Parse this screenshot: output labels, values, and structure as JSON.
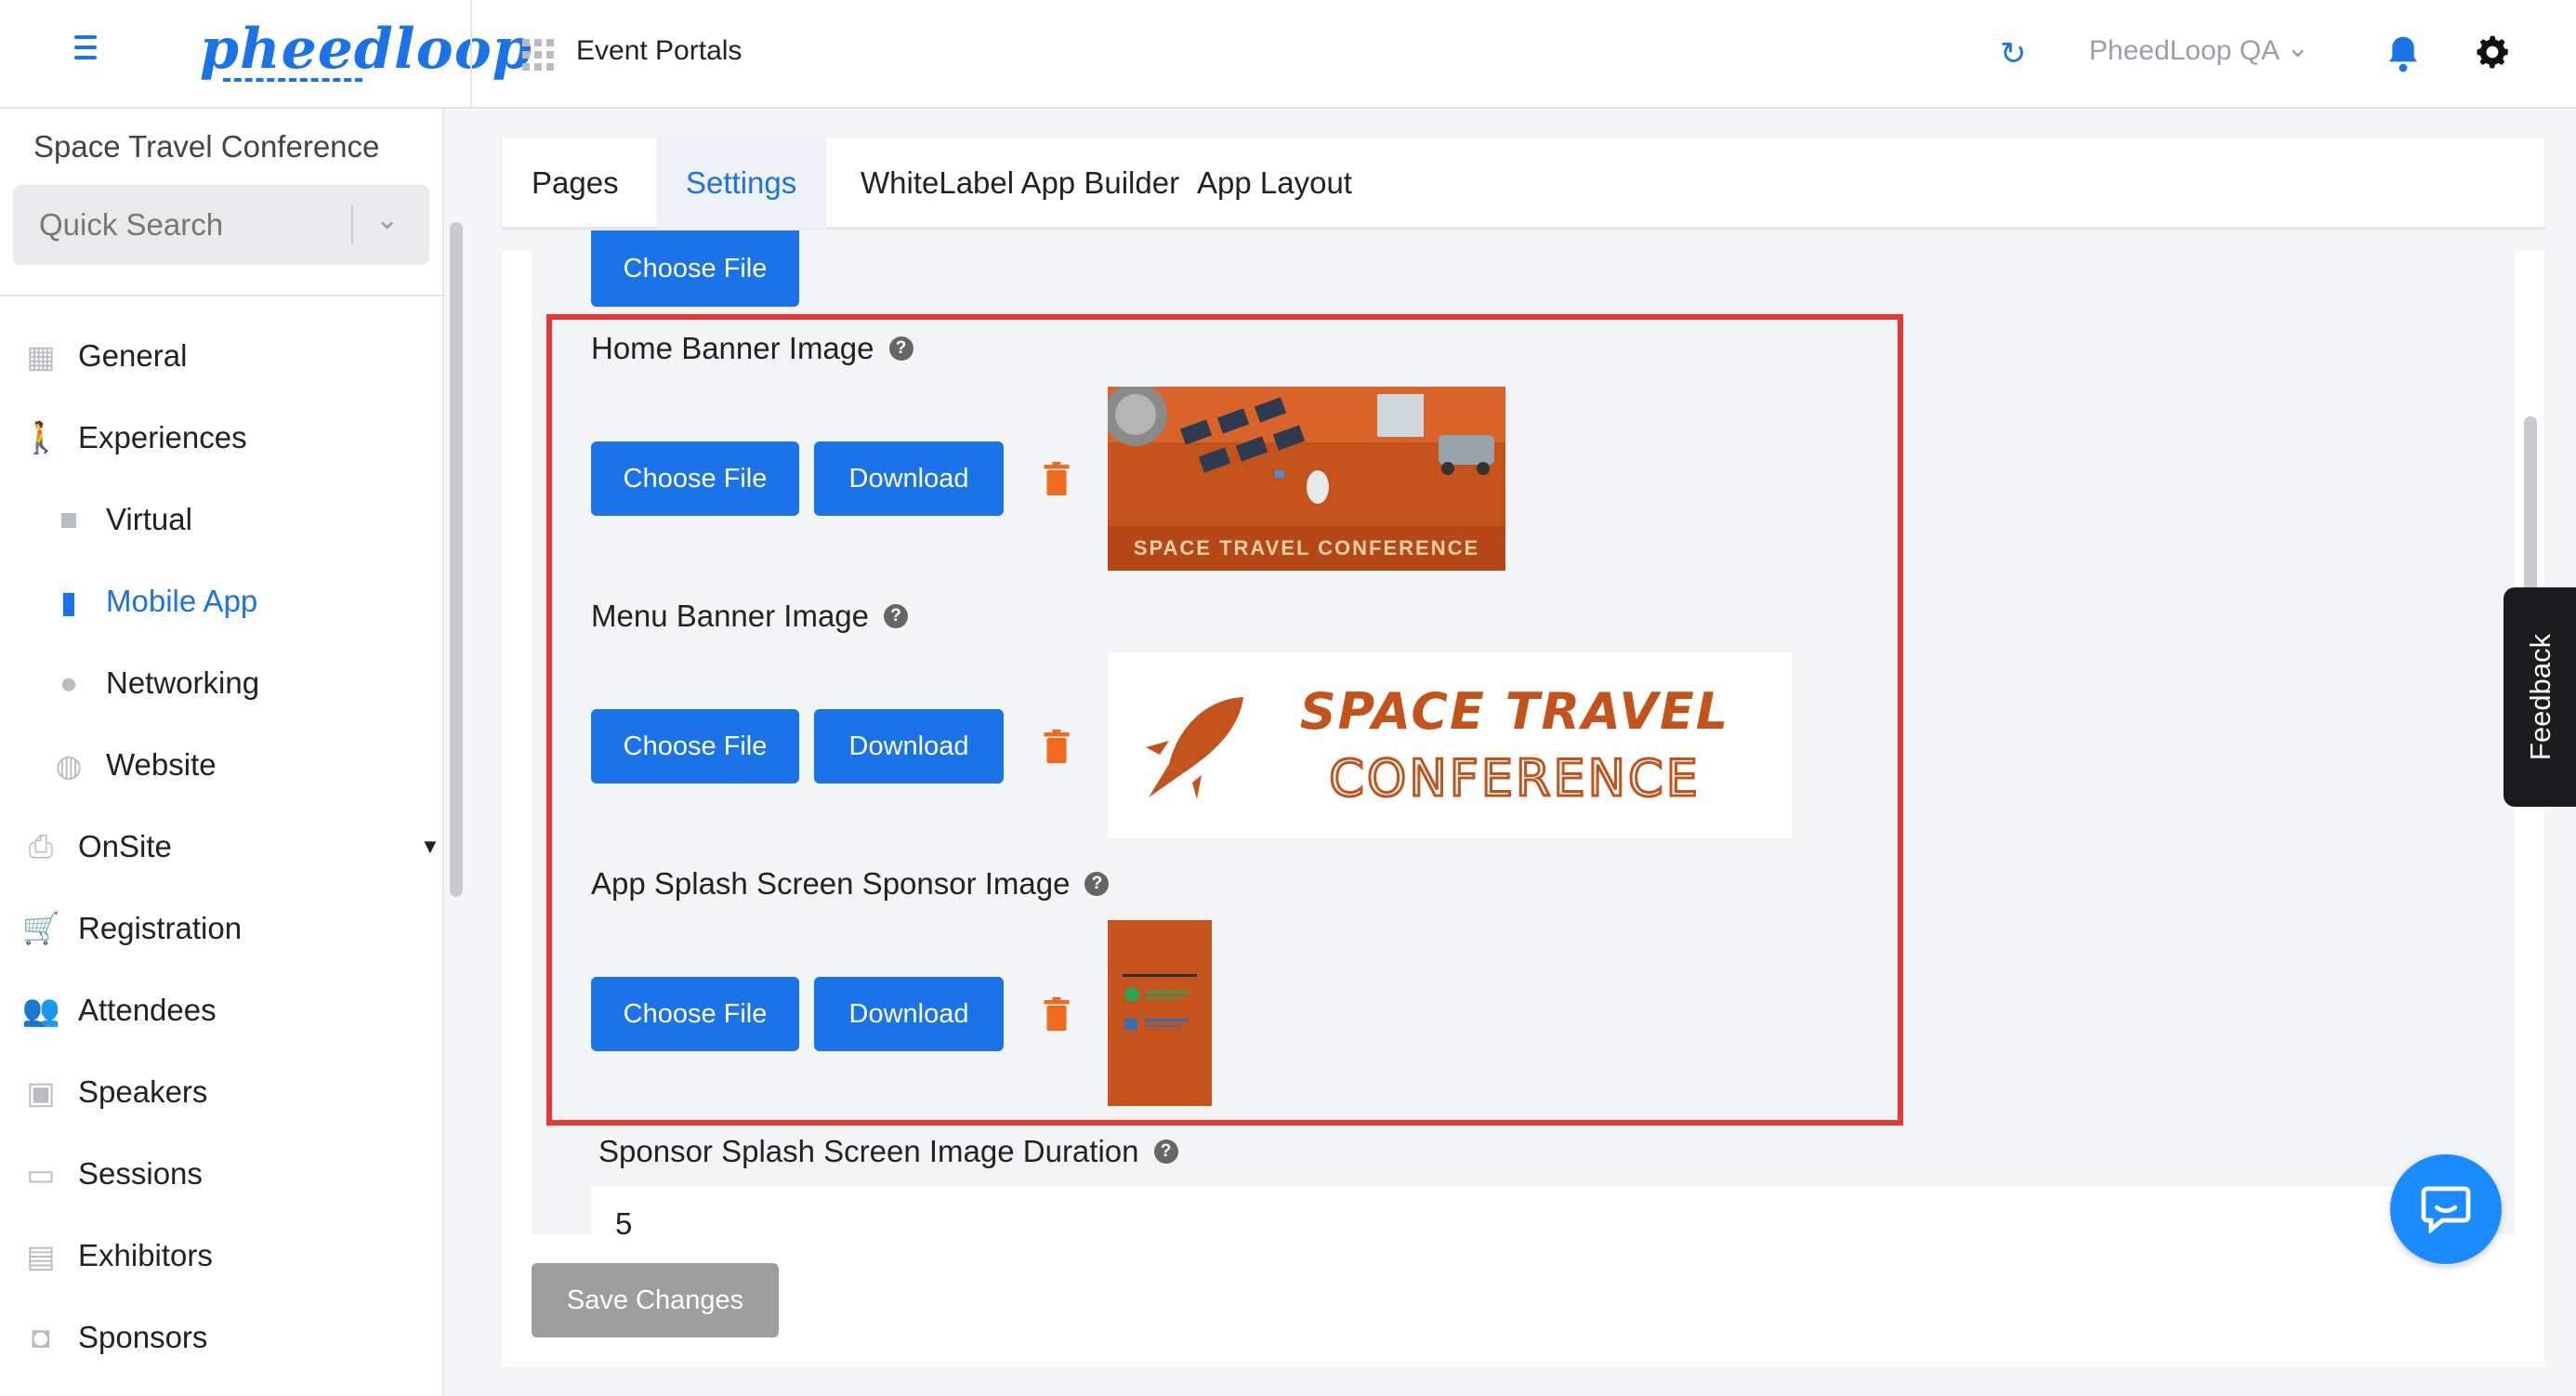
{
  "header": {
    "logo_text": "pheedloop",
    "portal_label": "Event Portals",
    "org_name": "PheedLoop QA"
  },
  "sidebar": {
    "event_name": "Space Travel Conference",
    "search_placeholder": "Quick Search",
    "items": [
      {
        "label": "General",
        "icon": "grid-icon"
      },
      {
        "label": "Experiences",
        "icon": "person-icon"
      },
      {
        "label": "Virtual",
        "icon": "video-icon"
      },
      {
        "label": "Mobile App",
        "icon": "mobile-icon",
        "active": true
      },
      {
        "label": "Networking",
        "icon": "chat-bubble-icon"
      },
      {
        "label": "Website",
        "icon": "globe-icon"
      },
      {
        "label": "OnSite",
        "icon": "printer-icon"
      },
      {
        "label": "Registration",
        "icon": "cart-icon"
      },
      {
        "label": "Attendees",
        "icon": "people-icon"
      },
      {
        "label": "Speakers",
        "icon": "presenter-icon"
      },
      {
        "label": "Sessions",
        "icon": "laptop-icon"
      },
      {
        "label": "Exhibitors",
        "icon": "storefront-icon"
      },
      {
        "label": "Sponsors",
        "icon": "badge-icon"
      }
    ]
  },
  "tabs": [
    {
      "label": "Pages"
    },
    {
      "label": "Settings",
      "active": true
    },
    {
      "label": "WhiteLabel App Builder"
    },
    {
      "label": "App Layout"
    }
  ],
  "form": {
    "top_choose_label": "Choose File",
    "home_banner": {
      "label": "Home Banner Image",
      "choose": "Choose File",
      "download": "Download"
    },
    "menu_banner": {
      "label": "Menu Banner Image",
      "choose": "Choose File",
      "download": "Download"
    },
    "splash_sponsor": {
      "label": "App Splash Screen Sponsor Image",
      "choose": "Choose File",
      "download": "Download"
    },
    "duration": {
      "label": "Sponsor Splash Screen Image Duration",
      "value": "5"
    },
    "save_label": "Save Changes"
  },
  "images": {
    "home_banner_text": "SPACE TRAVEL CONFERENCE",
    "menu_banner_line1": "SPACE TRAVEL",
    "menu_banner_line2": "CONFERENCE"
  },
  "feedback_label": "Feedback",
  "colors": {
    "accent": "#1a73e8",
    "highlight": "#e53935",
    "banner_orange": "#c4531b",
    "trash": "#f26b1d"
  }
}
